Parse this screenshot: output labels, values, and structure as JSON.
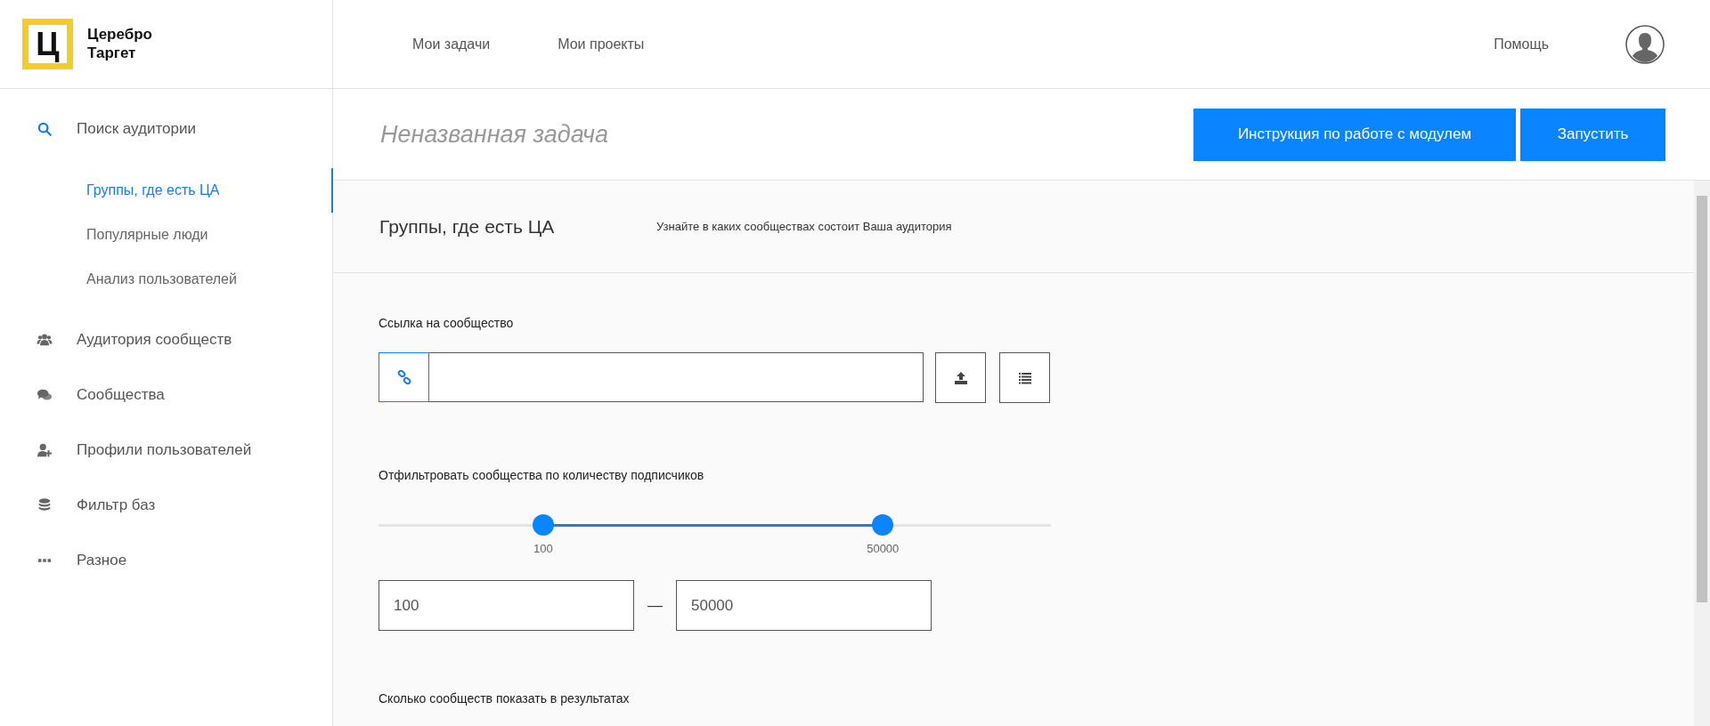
{
  "logo": {
    "mark": "Ц",
    "lines": [
      "Церебро",
      "Таргет"
    ]
  },
  "top_nav": [
    {
      "label": "Мои задачи"
    },
    {
      "label": "Мои проекты"
    }
  ],
  "help_link": "Помощь",
  "sidebar": {
    "items": [
      {
        "label": "Поиск аудитории",
        "expanded": true,
        "children": [
          {
            "label": "Группы, где есть ЦА",
            "selected": true
          },
          {
            "label": "Популярные люди",
            "selected": false
          },
          {
            "label": "Анализ пользователей",
            "selected": false
          }
        ]
      },
      {
        "label": "Аудитория сообществ",
        "expanded": false
      },
      {
        "label": "Сообщества",
        "expanded": false
      },
      {
        "label": "Профили пользователей",
        "expanded": false
      },
      {
        "label": "Фильтр баз",
        "expanded": false
      },
      {
        "label": "Разное",
        "expanded": false
      }
    ]
  },
  "task": {
    "title": "Неназванная задача",
    "buttons": [
      "Инструкция по работе с модулем",
      "Запустить"
    ]
  },
  "section": {
    "title": "Группы, где есть ЦА",
    "description": "Узнайте в каких сообществах состоит Ваша аудитория"
  },
  "link_field": {
    "label": "Ссылка на сообщество"
  },
  "filter": {
    "label": "Отфильтровать сообщества по количеству подписчиков",
    "slider": {
      "thumbs": [
        {
          "level": 0.245,
          "label": "100"
        },
        {
          "level": 0.75,
          "label": "50000"
        }
      ]
    },
    "min_value": "100",
    "separator": "—",
    "max_value": "50000"
  },
  "results_label": "Сколько сообществ показать в результатах"
}
